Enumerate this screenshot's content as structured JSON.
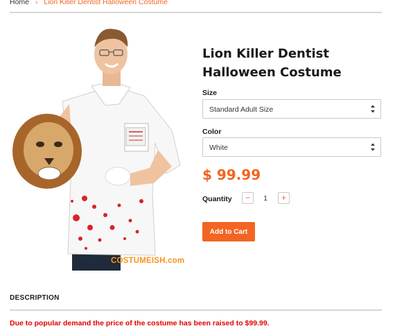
{
  "breadcrumb": {
    "home": "Home",
    "separator": "›",
    "current": "Lion Killer Dentist Halloween Costume"
  },
  "product": {
    "title": "Lion Killer Dentist Halloween Costume",
    "image_watermark": "COSTUMEISH.com",
    "size_label": "Size",
    "size_value": "Standard Adult Size",
    "color_label": "Color",
    "color_value": "White",
    "price": "$ 99.99",
    "quantity_label": "Quantity",
    "quantity_value": "1",
    "decrement_symbol": "−",
    "increment_symbol": "+",
    "add_to_cart_label": "Add to Cart"
  },
  "description": {
    "heading": "DESCRIPTION",
    "text": "Due to popular demand the price of the costume has been raised to $99.99."
  },
  "colors": {
    "accent": "#f26522",
    "alert_text": "#e00000",
    "rule": "#d6d6d6"
  }
}
